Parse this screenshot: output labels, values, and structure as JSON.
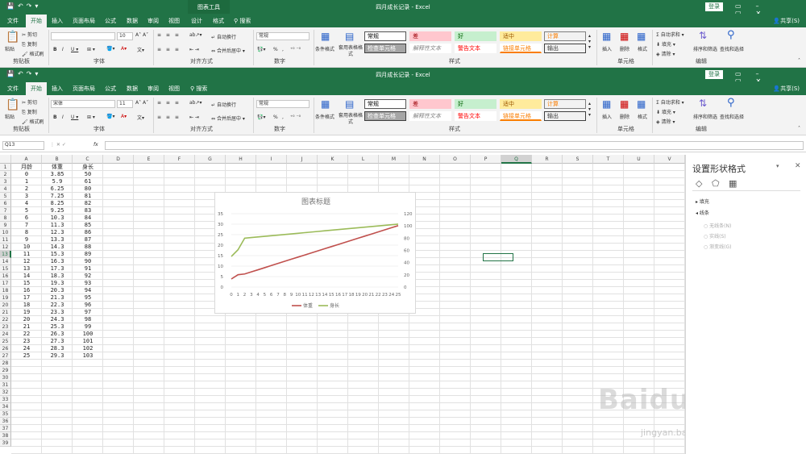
{
  "window": {
    "title": "四月成长记录 - Excel",
    "chart_tools": "图表工具",
    "login": "登录",
    "share": "共享(S)"
  },
  "tabs_top": [
    "文件",
    "开始",
    "插入",
    "页面布局",
    "公式",
    "数据",
    "审阅",
    "视图",
    "设计",
    "格式"
  ],
  "tabs_bottom": [
    "文件",
    "开始",
    "插入",
    "页面布局",
    "公式",
    "数据",
    "审阅",
    "视图"
  ],
  "search": "搜索",
  "ribbon": {
    "clipboard": {
      "paste": "粘贴",
      "cut": "剪切",
      "copy": "复制",
      "painter": "格式刷",
      "label": "剪贴板"
    },
    "font": {
      "name_top": "",
      "name_bottom": "宋体",
      "size_top": "10",
      "size_bottom": "11",
      "label": "字体"
    },
    "align": {
      "wrap": "自动换行",
      "merge": "合并后居中",
      "label": "对齐方式"
    },
    "number": {
      "format": "常规",
      "percent": "%",
      "label": "数字"
    },
    "styles": {
      "cond": "条件格式",
      "table": "套用表格格式",
      "label": "样式",
      "cells": [
        "常规",
        "差",
        "好",
        "适中",
        "计算",
        "检查单元格",
        "解释性文本",
        "警告文本",
        "链接单元格",
        "输出"
      ]
    },
    "cells": {
      "insert": "插入",
      "delete": "删除",
      "format": "格式",
      "label": "单元格"
    },
    "edit": {
      "autosum": "自动求和",
      "fill": "填充",
      "clear": "清除",
      "sort": "排序和筛选",
      "find": "查找和选择",
      "label": "编辑"
    }
  },
  "formula_bar": {
    "name_box": "Q13",
    "fx": "fx",
    "value": ""
  },
  "columns": [
    "A",
    "B",
    "C",
    "D",
    "E",
    "F",
    "G",
    "H",
    "I",
    "J",
    "K",
    "L",
    "M",
    "N",
    "O",
    "P",
    "Q",
    "R",
    "S",
    "T",
    "U",
    "V"
  ],
  "rows": [
    "1",
    "2",
    "3",
    "4",
    "5",
    "6",
    "7",
    "8",
    "9",
    "10",
    "11",
    "12",
    "13",
    "14",
    "15",
    "16",
    "17",
    "18",
    "19",
    "20",
    "21",
    "22",
    "23",
    "24",
    "25",
    "26",
    "27",
    "28",
    "29",
    "30",
    "31",
    "32",
    "33",
    "34",
    "35",
    "36",
    "37",
    "38",
    "39"
  ],
  "table": {
    "headers": [
      "月龄",
      "体重",
      "身长"
    ],
    "rows": [
      [
        "0",
        "3.85",
        "50"
      ],
      [
        "1",
        "5.9",
        "61"
      ],
      [
        "2",
        "6.25",
        "80"
      ],
      [
        "3",
        "7.25",
        "81"
      ],
      [
        "4",
        "8.25",
        "82"
      ],
      [
        "5",
        "9.25",
        "83"
      ],
      [
        "6",
        "10.3",
        "84"
      ],
      [
        "7",
        "11.3",
        "85"
      ],
      [
        "8",
        "12.3",
        "86"
      ],
      [
        "9",
        "13.3",
        "87"
      ],
      [
        "10",
        "14.3",
        "88"
      ],
      [
        "11",
        "15.3",
        "89"
      ],
      [
        "12",
        "16.3",
        "90"
      ],
      [
        "13",
        "17.3",
        "91"
      ],
      [
        "14",
        "18.3",
        "92"
      ],
      [
        "15",
        "19.3",
        "93"
      ],
      [
        "16",
        "20.3",
        "94"
      ],
      [
        "17",
        "21.3",
        "95"
      ],
      [
        "18",
        "22.3",
        "96"
      ],
      [
        "19",
        "23.3",
        "97"
      ],
      [
        "20",
        "24.3",
        "98"
      ],
      [
        "21",
        "25.3",
        "99"
      ],
      [
        "22",
        "26.3",
        "100"
      ],
      [
        "23",
        "27.3",
        "101"
      ],
      [
        "24",
        "28.3",
        "102"
      ],
      [
        "25",
        "29.3",
        "103"
      ]
    ]
  },
  "chart_data": {
    "type": "line",
    "title": "图表标题",
    "x": [
      0,
      1,
      2,
      3,
      4,
      5,
      6,
      7,
      8,
      9,
      10,
      11,
      12,
      13,
      14,
      15,
      16,
      17,
      18,
      19,
      20,
      21,
      22,
      23,
      24,
      25
    ],
    "y_left_ticks": [
      0,
      5,
      10,
      15,
      20,
      25,
      30,
      35
    ],
    "y_right_ticks": [
      0,
      20,
      40,
      60,
      80,
      100,
      120
    ],
    "ylim_left": [
      0,
      35
    ],
    "ylim_right": [
      0,
      120
    ],
    "series": [
      {
        "name": "体重",
        "axis": "left",
        "color": "#c0504d",
        "values": [
          3.85,
          5.9,
          6.25,
          7.25,
          8.25,
          9.25,
          10.3,
          11.3,
          12.3,
          13.3,
          14.3,
          15.3,
          16.3,
          17.3,
          18.3,
          19.3,
          20.3,
          21.3,
          22.3,
          23.3,
          24.3,
          25.3,
          26.3,
          27.3,
          28.3,
          29.3
        ]
      },
      {
        "name": "身长",
        "axis": "right",
        "color": "#9bbb59",
        "values": [
          50,
          61,
          80,
          81,
          82,
          83,
          84,
          85,
          86,
          87,
          88,
          89,
          90,
          91,
          92,
          93,
          94,
          95,
          96,
          97,
          98,
          99,
          100,
          101,
          102,
          103
        ]
      }
    ],
    "legend": "bottom"
  },
  "panel": {
    "title": "设置形状格式",
    "fill": "填充",
    "line": "线条",
    "opt1": "无线条(N)",
    "opt2": "实线(S)",
    "opt3": "渐变线(G)"
  },
  "watermark": {
    "brand": "Baidu经验",
    "url": "jingyan.baidu.com"
  }
}
